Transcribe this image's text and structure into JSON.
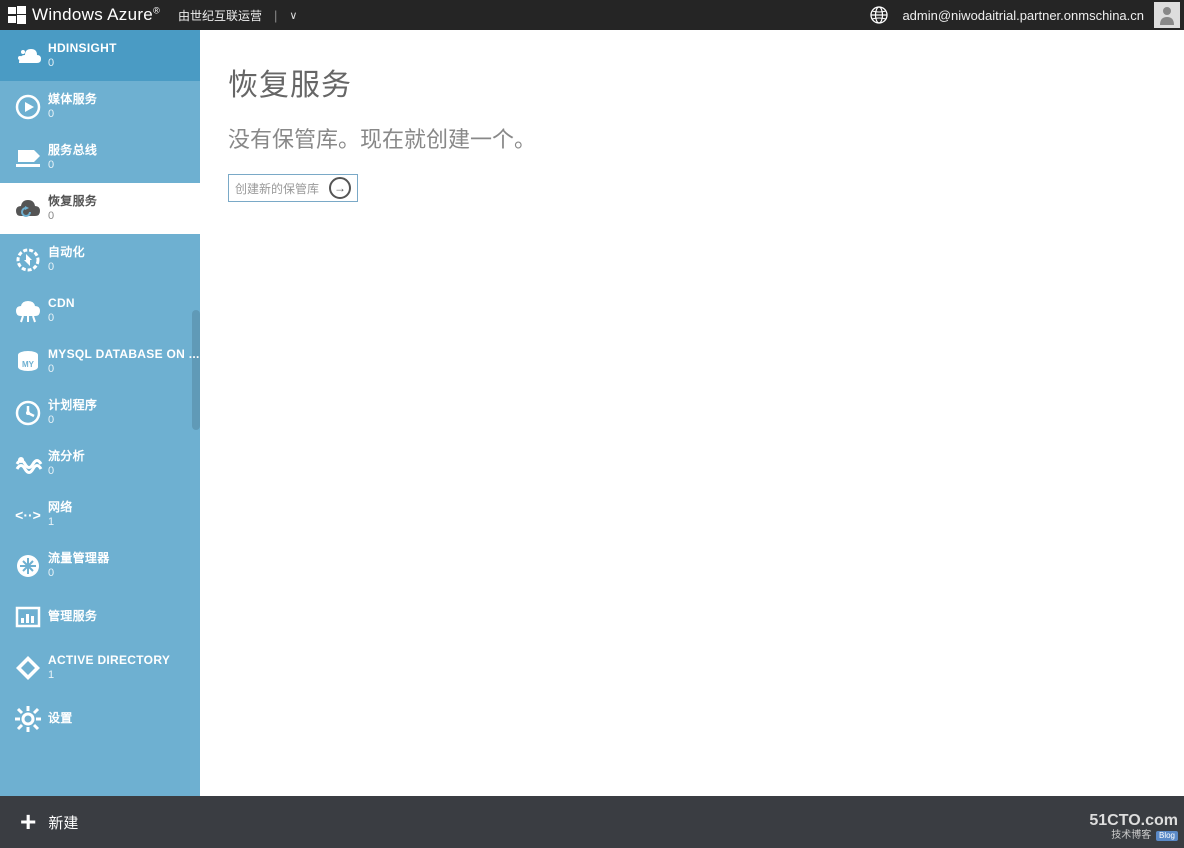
{
  "header": {
    "brand": "Windows Azure",
    "brand_suffix": "®",
    "operator": "由世纪互联运营",
    "divider": "|",
    "chevron": "∨",
    "user_email": "admin@niwodaitrial.partner.onmschina.cn"
  },
  "sidebar": {
    "items": [
      {
        "id": "hdinsight",
        "label": "HDINSIGHT",
        "count": "0",
        "icon": "hdinsight-icon",
        "state": "highlight"
      },
      {
        "id": "media",
        "label": "媒体服务",
        "count": "0",
        "icon": "media-icon",
        "state": ""
      },
      {
        "id": "servicebus",
        "label": "服务总线",
        "count": "0",
        "icon": "servicebus-icon",
        "state": ""
      },
      {
        "id": "recovery",
        "label": "恢复服务",
        "count": "0",
        "icon": "recovery-icon",
        "state": "selected"
      },
      {
        "id": "automation",
        "label": "自动化",
        "count": "0",
        "icon": "automation-icon",
        "state": ""
      },
      {
        "id": "cdn",
        "label": "CDN",
        "count": "0",
        "icon": "cdn-icon",
        "state": ""
      },
      {
        "id": "mysql",
        "label": "MYSQL DATABASE ON ...",
        "count": "0",
        "icon": "mysql-icon",
        "state": ""
      },
      {
        "id": "scheduler",
        "label": "计划程序",
        "count": "0",
        "icon": "scheduler-icon",
        "state": ""
      },
      {
        "id": "streamanalytics",
        "label": "流分析",
        "count": "0",
        "icon": "streamanalytics-icon",
        "state": ""
      },
      {
        "id": "network",
        "label": "网络",
        "count": "1",
        "icon": "network-icon",
        "state": ""
      },
      {
        "id": "trafficmanager",
        "label": "流量管理器",
        "count": "0",
        "icon": "trafficmanager-icon",
        "state": ""
      },
      {
        "id": "mgmtservices",
        "label": "管理服务",
        "count": "",
        "icon": "mgmt-icon",
        "state": ""
      },
      {
        "id": "activedirectory",
        "label": "ACTIVE DIRECTORY",
        "count": "1",
        "icon": "ad-icon",
        "state": ""
      },
      {
        "id": "settings",
        "label": "设置",
        "count": "",
        "icon": "settings-icon",
        "state": ""
      }
    ]
  },
  "main": {
    "title": "恢复服务",
    "subtitle": "没有保管库。现在就创建一个。",
    "create_label": "创建新的保管库"
  },
  "bottombar": {
    "new_label": "新建"
  },
  "watermark": {
    "line1": "51CTO.com",
    "line2": "技术博客",
    "badge": "Blog"
  }
}
